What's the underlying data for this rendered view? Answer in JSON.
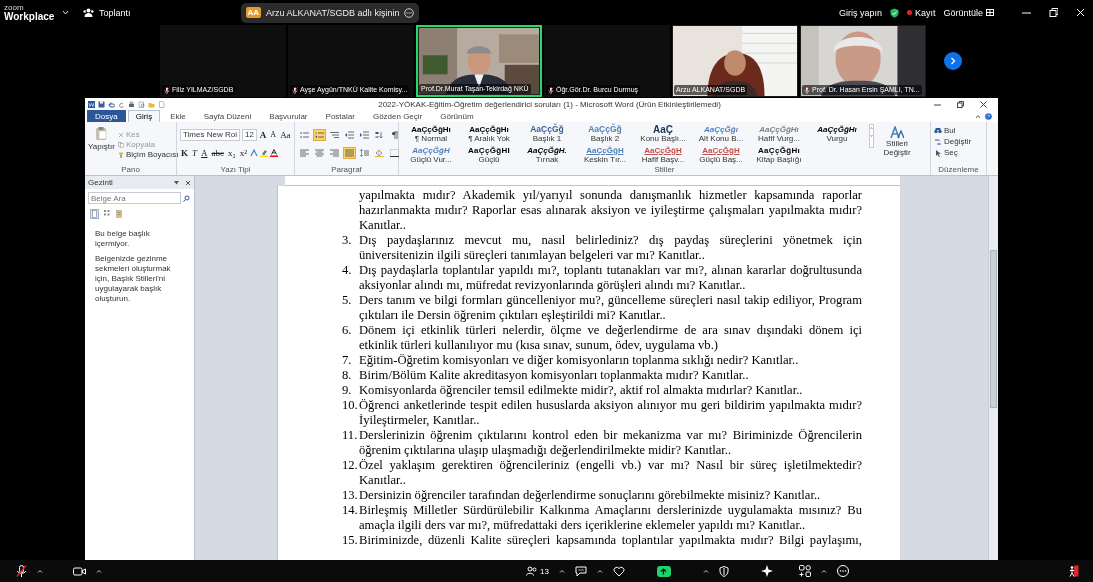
{
  "zoom_bar": {
    "logo_top": "zoom",
    "logo_bottom": "Workplace",
    "meeting_label": "Toplantı",
    "share_banner": "Arzu ALKANAT/SGDB adlı kişinin",
    "share_avatar": "AA",
    "sign_in": "Giriş yapın",
    "record": "Kayıt",
    "view": "Görüntüle"
  },
  "video_tiles": [
    {
      "name": "Filiz YILMAZ/SGDB",
      "muted": true,
      "video": false,
      "active": false
    },
    {
      "name": "Ayşe Aygün/TNKÜ Kalite Komisy...",
      "muted": true,
      "video": false,
      "active": false
    },
    {
      "name": "Prof.Dr.Murat Taşan-Tekirdağ NKÜ",
      "muted": false,
      "video": true,
      "active": true
    },
    {
      "name": "Öğr.Gör.Dr. Burcu Durmuş",
      "muted": true,
      "video": false,
      "active": false
    },
    {
      "name": "Arzu ALKANAT/SGDB",
      "muted": false,
      "video": true,
      "active": false
    },
    {
      "name": "Prof. Dr. Hasan Ersin ŞAMLI, TN...",
      "muted": true,
      "video": true,
      "active": false
    }
  ],
  "word": {
    "title": "2022-YÖKAK-Eğitim-Öğretim değerlendirici soruları (1) - Microsoft Word (Ürün Etkinleştirilemedi)",
    "tabs": [
      {
        "label": "Dosya",
        "kind": "file",
        "selected": false
      },
      {
        "label": "Giriş",
        "kind": "tab",
        "selected": true
      },
      {
        "label": "Ekle",
        "kind": "tab",
        "selected": false
      },
      {
        "label": "Sayfa Düzeni",
        "kind": "tab",
        "selected": false
      },
      {
        "label": "Başvurular",
        "kind": "tab",
        "selected": false
      },
      {
        "label": "Postalar",
        "kind": "tab",
        "selected": false
      },
      {
        "label": "Gözden Geçir",
        "kind": "tab",
        "selected": false
      },
      {
        "label": "Görünüm",
        "kind": "tab",
        "selected": false
      }
    ],
    "clipboard": {
      "paste": "Yapıştır",
      "items": [
        {
          "label": "Kes",
          "disabled": true
        },
        {
          "label": "Kopyala",
          "disabled": true
        },
        {
          "label": "Biçim Boyacısı",
          "disabled": false
        }
      ],
      "group": "Pano"
    },
    "font": {
      "name": "Times New Roi",
      "size": "12",
      "row1": [
        "A",
        "A",
        "Aa"
      ],
      "row2": [
        "K",
        "T",
        "A",
        "abc",
        "x₂",
        "x²"
      ],
      "group": "Yazı Tipi"
    },
    "paragraph": {
      "row1": [
        {
          "kind": "bullets",
          "selected": false
        },
        {
          "kind": "numbering",
          "selected": true
        },
        {
          "kind": "multilevel",
          "selected": false
        },
        {
          "kind": "outdent",
          "selected": false
        },
        {
          "kind": "indent",
          "selected": false
        },
        {
          "kind": "sort",
          "selected": false
        },
        {
          "kind": "marks",
          "selected": false
        }
      ],
      "row2": [
        {
          "kind": "left",
          "selected": false
        },
        {
          "kind": "center",
          "selected": false
        },
        {
          "kind": "right",
          "selected": false
        },
        {
          "kind": "justify",
          "selected": true
        },
        {
          "kind": "spacing",
          "selected": false
        },
        {
          "kind": "shading",
          "selected": false
        },
        {
          "kind": "borders",
          "selected": false
        }
      ],
      "group": "Paragraf"
    },
    "styles": {
      "items": [
        {
          "sample": "AaÇçĞğHı",
          "label": "¶ Normal",
          "kind": "normal",
          "color": "#000000"
        },
        {
          "sample": "AaÇçĞğHı",
          "label": "¶ Aralık Yok",
          "kind": "normal",
          "color": "#000000"
        },
        {
          "sample": "AaÇçĞğ",
          "label": "Başlık 1",
          "kind": "heading",
          "color": "#365f91"
        },
        {
          "sample": "AaÇçĞğ",
          "label": "Başlık 2",
          "kind": "heading",
          "color": "#4f81bd"
        },
        {
          "sample": "AaÇ",
          "label": "Konu Başlı...",
          "kind": "title",
          "color": "#17365d"
        },
        {
          "sample": "AaÇçĞğı",
          "label": "Alt Konu B...",
          "kind": "italic",
          "color": "#4f81bd"
        },
        {
          "sample": "AaÇçĞğHı",
          "label": "Hafif Vurg...",
          "kind": "italic",
          "color": "#808080"
        },
        {
          "sample": "AaÇçĞğHı",
          "label": "Vurgu",
          "kind": "italic",
          "color": "#000000"
        },
        {
          "sample": "AaÇçĞğH",
          "label": "Güçlü Vur...",
          "kind": "bolditalic",
          "color": "#4f81bd"
        },
        {
          "sample": "AaÇçĞğHI",
          "label": "Güçlü",
          "kind": "bold",
          "color": "#000000"
        },
        {
          "sample": "AaÇçĞğH.",
          "label": "Tırnak",
          "kind": "italic",
          "color": "#000000"
        },
        {
          "sample": "AaÇçĞğH",
          "label": "Keskin Tır...",
          "kind": "underline",
          "color": "#4f81bd"
        },
        {
          "sample": "AaÇçĞğH",
          "label": "Hafif Başv...",
          "kind": "underline",
          "color": "#c0504d"
        },
        {
          "sample": "AaÇçĞğH",
          "label": "Güçlü Baş...",
          "kind": "underline",
          "color": "#c0504d"
        },
        {
          "sample": "AaÇçĞğHı",
          "label": "Kitap Başlığı",
          "kind": "bold",
          "color": "#000000"
        }
      ],
      "change": "Stilleri Değiştir",
      "group": "Stiller"
    },
    "editing": {
      "items": [
        "Bul",
        "Değiştir",
        "Seç"
      ],
      "group": "Düzenleme"
    },
    "nav_pane": {
      "title": "Gezinti",
      "search_placeholder": "Belge Ara",
      "views": [
        {
          "kind": "headings",
          "selected": true
        },
        {
          "kind": "pages",
          "selected": false
        },
        {
          "kind": "results",
          "selected": false
        }
      ],
      "message": "Bu belge başlık içermiyor.",
      "hint": "Belgenizde gezinme sekmeleri oluşturmak için, Başlık Stilleri'ni uygulayarak başlık oluşturun."
    },
    "document": [
      {
        "kind": "continued",
        "text": "yapılmakta mıdır? Akademik yıl/yarıyıl sonunda danışmanlık hizmetler kapsamında raporlar hazırlanmakta mıdır? Raporlar esas alınarak aksiyon ve iyileştirme çalışmaları yapılmakta mıdır? Kanıtlar.."
      },
      {
        "kind": "item",
        "number": "3.",
        "text": "Dış paydaşlarınız mevcut mu, nasıl belirlediniz? dış paydaş süreçlerini yönetmek için üniversitenizin ilgili süreçleri tanımlayan belgeleri var mı? Kanıtlar.."
      },
      {
        "kind": "item",
        "number": "4.",
        "text": "Dış paydaşlarla toplantılar yapıldı mı?, toplantı tutanakları var mı?, alınan kararlar doğrultusunda aksiyonlar alındı mı, müfredat revizyonlarında görüşleri alındı mı? Kanıtlar.."
      },
      {
        "kind": "item",
        "number": "5.",
        "text": "Ders tanım ve bilgi formları güncelleniyor mu?, güncelleme süreçleri nasıl takip ediliyor, Program çıktıları ile Dersin öğrenim çıktıları eşleştirildi mi? Kanıtlar.."
      },
      {
        "kind": "item",
        "number": "6.",
        "text": "Dönem içi etkinlik türleri nelerdir, ölçme ve değerlendirme de ara sınav dışındaki dönem içi etkinlik türleri kullanılıyor mu (kısa sınav, sunum, ödev, uygulama vb.)"
      },
      {
        "kind": "item",
        "number": "7.",
        "text": "Eğitim-Öğretim komisyonları ve diğer komisyonların toplanma sıklığı nedir? Kanıtlar.."
      },
      {
        "kind": "item",
        "number": "8.",
        "text": "Birim/Bölüm Kalite akreditasyon komisyonları toplanmakta mıdır? Kanıtlar.."
      },
      {
        "kind": "item",
        "number": "9.",
        "text": "Komisyonlarda öğrenciler temsil edilmekte midir?, aktif rol almakta mıdırlar? Kanıtlar.."
      },
      {
        "kind": "item",
        "number": "10.",
        "text": "Öğrenci anketlerinde tespit edilen hususlarda aksiyon alınıyor mu geri bildirim yapılmakta mıdır? İyileştirmeler, Kanıtlar.."
      },
      {
        "kind": "item",
        "number": "11.",
        "text": "Derslerinizin öğrenim çıktılarını kontrol eden bir mekanizma var mı? Biriminizde Öğrencilerin öğrenim çıktılarına ulaşıp ulaşmadığı değerlendirilmekte midir? Kanıtlar.."
      },
      {
        "kind": "item",
        "number": "12.",
        "text": "Özel yaklaşım gerektiren öğrencileriniz (engelli vb.) var mı? Nasıl bir süreç işletilmektedir? Kanıtlar.."
      },
      {
        "kind": "item",
        "number": "13.",
        "text": "Dersinizin öğrenciler tarafından değerlendirme sonuçlarını görebilmekte misiniz? Kanıtlar.."
      },
      {
        "kind": "item",
        "number": "14.",
        "text": "Birleşmiş Milletler Sürdürülebilir Kalkınma Amaçlarını derslerinizde uygulamakta mısınız? Bu amaçla ilgili ders var mı?, müfredattaki ders içeriklerine eklemeler yapıldı mı? Kanıtlar.."
      },
      {
        "kind": "cut",
        "number": "15.",
        "text": "Biriminizde, düzenli Kalite süreçleri kapsamında toplantılar yapılmakta mıdır? Bilgi paylaşımı,"
      }
    ]
  },
  "toolbar": {
    "participants": "13",
    "mic_muted": true,
    "sharing": true
  }
}
